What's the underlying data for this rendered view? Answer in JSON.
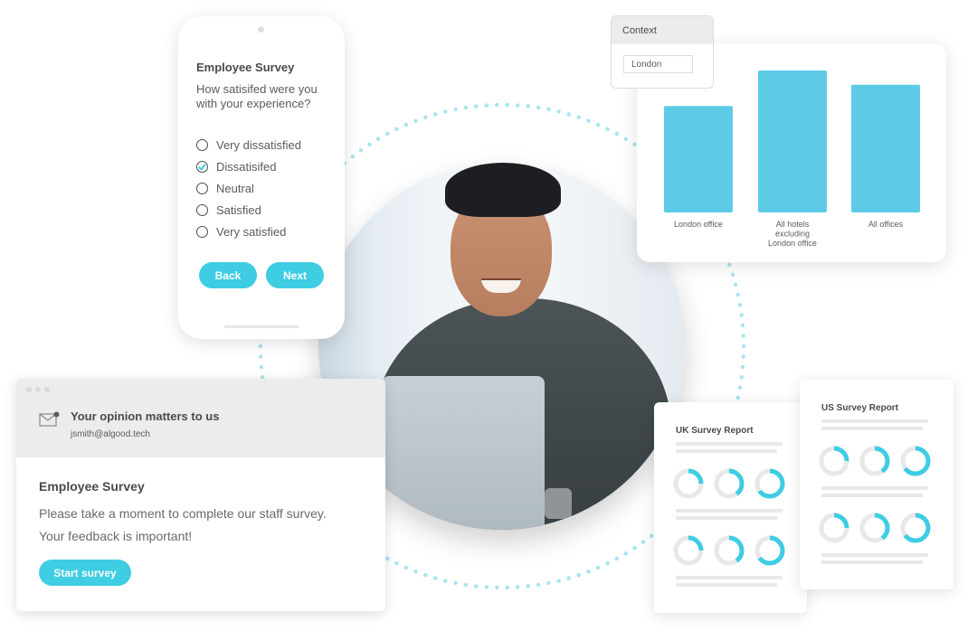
{
  "colors": {
    "accent": "#3ecde2",
    "bar": "#5ecbe6",
    "ring_dots": "#a6e4ef",
    "donut_track": "#e8e8e8",
    "panel_grey": "#ececec",
    "text": "#4a4a4a"
  },
  "phone_survey": {
    "title": "Employee Survey",
    "question": "How satisifed were you with your experience?",
    "options": [
      {
        "label": "Very dissatisfied",
        "checked": false
      },
      {
        "label": "Dissatisifed",
        "checked": true
      },
      {
        "label": "Neutral",
        "checked": false
      },
      {
        "label": "Satisfied",
        "checked": false
      },
      {
        "label": "Very satisfied",
        "checked": false
      }
    ],
    "back_label": "Back",
    "next_label": "Next"
  },
  "context_panel": {
    "title": "Context",
    "value": "London"
  },
  "chart_data": {
    "type": "bar",
    "title": "",
    "xlabel": "",
    "ylabel": "",
    "categories": [
      "London office",
      "All hotels excluding London office",
      "All offices"
    ],
    "category_lines": [
      [
        "London office"
      ],
      [
        "All hotels",
        "excluding",
        "London office"
      ],
      [
        "All offices"
      ]
    ],
    "values": [
      75,
      100,
      90
    ],
    "ylim": [
      0,
      100
    ],
    "grid": false,
    "legend": "none",
    "note": "relative values; no axis shown"
  },
  "email": {
    "subject": "Your opinion matters to us",
    "from": "jsmith@algood.tech",
    "title": "Employee Survey",
    "body_line1": "Please take a moment to complete our staff survey.",
    "body_line2": "Your feedback is important!",
    "button_label": "Start survey",
    "icon": "mail-unread-icon"
  },
  "reports": {
    "uk": {
      "title": "UK Survey Report",
      "donut_rows": [
        [
          0.25,
          0.4,
          0.65
        ],
        [
          0.25,
          0.4,
          0.65
        ]
      ]
    },
    "us": {
      "title": "US Survey Report",
      "donut_rows": [
        [
          0.25,
          0.4,
          0.65
        ],
        [
          0.25,
          0.4,
          0.65
        ]
      ]
    }
  },
  "photo": {
    "description": "Smiling man in checked shirt using a laptop"
  }
}
